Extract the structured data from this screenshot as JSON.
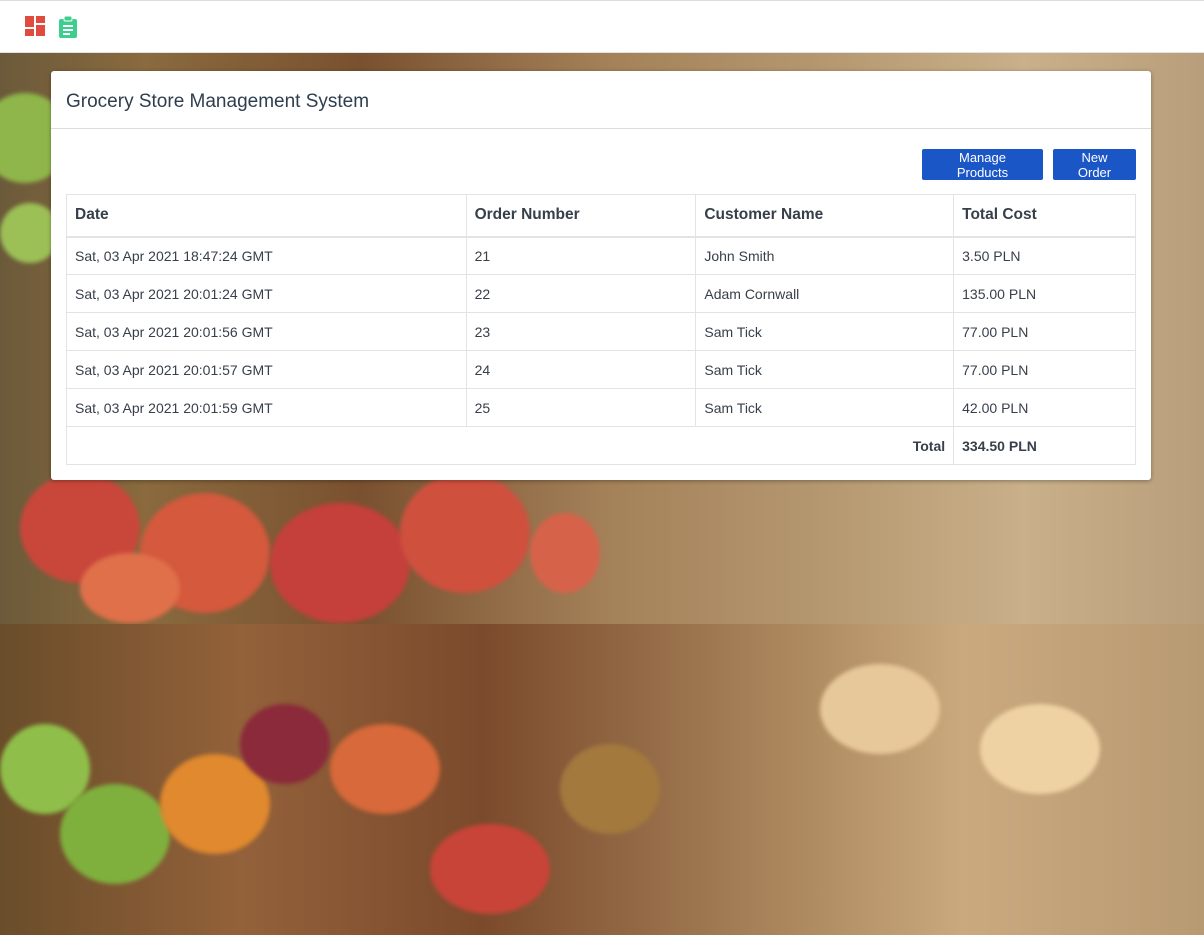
{
  "nav": {
    "icons": [
      "dashboard-icon",
      "clipboard-icon"
    ],
    "dashboard_color": "#e04a3f",
    "clipboard_color": "#3ecf8e"
  },
  "card": {
    "title": "Grocery Store Management System"
  },
  "toolbar": {
    "manage_label": "Manage Products",
    "new_order_label": "New Order",
    "button_color": "#1a56c6"
  },
  "orders": {
    "headers": [
      "Date",
      "Order Number",
      "Customer Name",
      "Total Cost"
    ],
    "rows": [
      {
        "date": "Sat, 03 Apr 2021 18:47:24 GMT",
        "number": "21",
        "customer": "John Smith",
        "total": "3.50 PLN"
      },
      {
        "date": "Sat, 03 Apr 2021 20:01:24 GMT",
        "number": "22",
        "customer": "Adam Cornwall",
        "total": "135.00 PLN"
      },
      {
        "date": "Sat, 03 Apr 2021 20:01:56 GMT",
        "number": "23",
        "customer": "Sam Tick",
        "total": "77.00 PLN"
      },
      {
        "date": "Sat, 03 Apr 2021 20:01:57 GMT",
        "number": "24",
        "customer": "Sam Tick",
        "total": "77.00 PLN"
      },
      {
        "date": "Sat, 03 Apr 2021 20:01:59 GMT",
        "number": "25",
        "customer": "Sam Tick",
        "total": "42.00 PLN"
      }
    ],
    "total_label": "Total",
    "total_value": "334.50 PLN"
  }
}
